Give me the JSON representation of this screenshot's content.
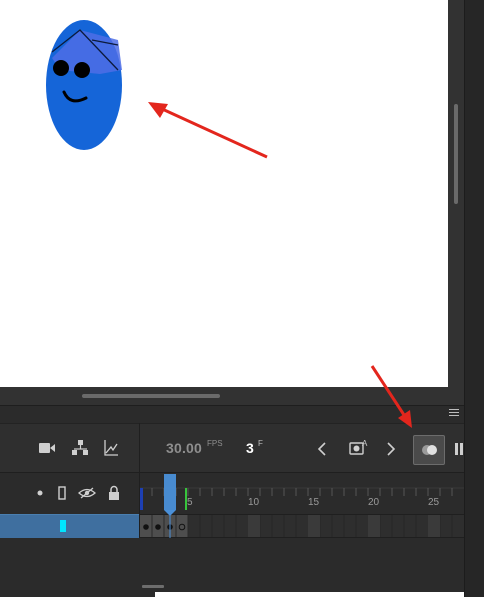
{
  "stage": {
    "background": "#ffffff",
    "character": {
      "fill": "#1565d8",
      "hat_fill": "#4d6de6",
      "eye_color": "#000000"
    },
    "annotations": {
      "arrow_color": "#e3261d"
    }
  },
  "timeline": {
    "fps_value": "30.00",
    "fps_unit": "FPS",
    "current_frame": "3",
    "frame_unit": "F",
    "ruler_labels": [
      "5",
      "10",
      "15",
      "20",
      "25"
    ],
    "playhead_color": "#4a90d9",
    "layer": {
      "color": "#00e5ff",
      "selected": true
    },
    "toolbar_icons": [
      "camera-icon",
      "parenting-icon",
      "graph-icon",
      "previous-frame-icon",
      "insert-keyframe-icon",
      "next-frame-icon",
      "onion-skin-icon",
      "edit-multiple-frames-icon"
    ],
    "header_icons": [
      "dot-icon",
      "outline-icon",
      "hide-eye-icon",
      "lock-icon"
    ]
  }
}
